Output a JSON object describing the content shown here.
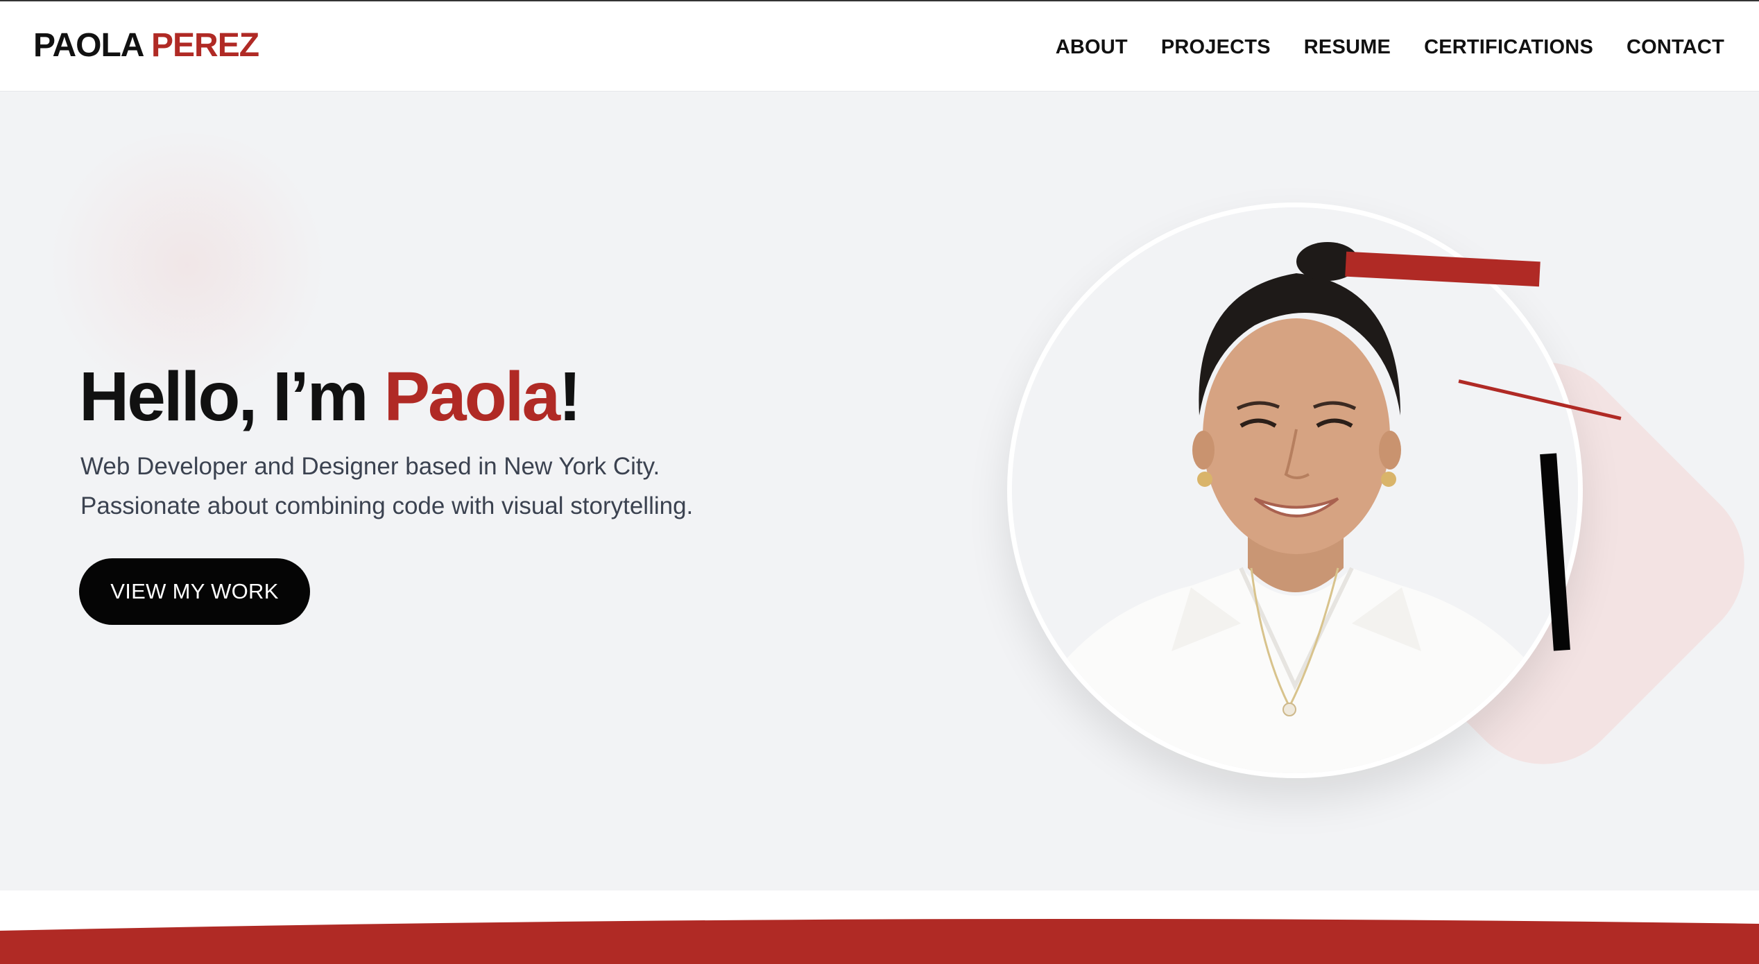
{
  "header": {
    "logo_first": "PAOLA",
    "logo_last": "PEREZ",
    "nav": [
      "ABOUT",
      "PROJECTS",
      "RESUME",
      "CERTIFICATIONS",
      "CONTACT"
    ]
  },
  "hero": {
    "headline_prefix": "Hello, I’m ",
    "headline_name": "Paola",
    "headline_suffix": "!",
    "tagline_line1": "Web Developer and Designer based in New York City.",
    "tagline_line2": "Passionate about combining code with visual storytelling.",
    "cta_label": "VIEW MY WORK"
  },
  "colors": {
    "accent": "#b02a25",
    "text": "#111111",
    "hero_bg": "#f2f3f5",
    "button_bg": "#050505",
    "soft_pink": "#f3e3e3"
  }
}
